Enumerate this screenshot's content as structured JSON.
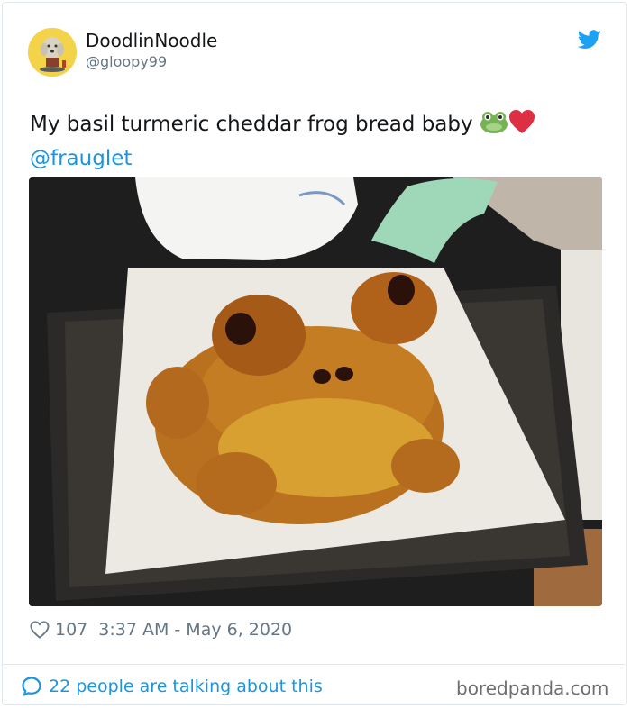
{
  "author": {
    "display_name": "DoodlinNoodle",
    "handle": "@gloopy99"
  },
  "tweet": {
    "text": "My basil turmeric cheddar frog bread baby",
    "emojis": [
      "frog-face",
      "red-heart"
    ],
    "mention": "@frauglet"
  },
  "photo": {
    "description_icon": "bread-frog-photo"
  },
  "meta": {
    "likes": "107",
    "timestamp": "3:37 AM - May 6, 2020"
  },
  "footer": {
    "conversation": "22 people are talking about this"
  },
  "watermark": "boredpanda.com",
  "colors": {
    "link": "#1b95e0",
    "muted": "#657786",
    "border": "#e1e8ed"
  }
}
